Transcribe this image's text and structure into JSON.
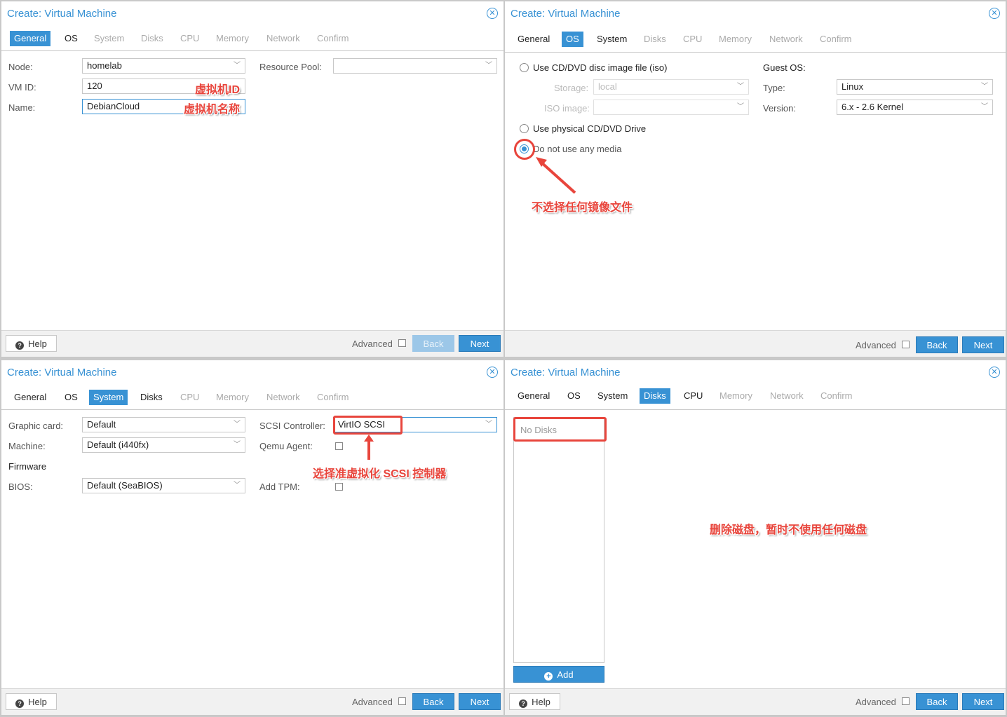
{
  "dialog_title": "Create: Virtual Machine",
  "tabs": [
    "General",
    "OS",
    "System",
    "Disks",
    "CPU",
    "Memory",
    "Network",
    "Confirm"
  ],
  "footer": {
    "help": "Help",
    "advanced": "Advanced",
    "back": "Back",
    "next": "Next",
    "add": "Add"
  },
  "general": {
    "node_label": "Node:",
    "node_value": "homelab",
    "vmid_label": "VM ID:",
    "vmid_value": "120",
    "name_label": "Name:",
    "name_value": "DebianCloud",
    "pool_label": "Resource Pool:",
    "anno_vmid": "虚拟机ID",
    "anno_name": "虚拟机名称"
  },
  "os": {
    "iso_option": "Use CD/DVD disc image file (iso)",
    "storage_label": "Storage:",
    "storage_value": "local",
    "iso_label": "ISO image:",
    "physical_option": "Use physical CD/DVD Drive",
    "none_option": "Do not use any media",
    "guest_label": "Guest OS:",
    "type_label": "Type:",
    "type_value": "Linux",
    "version_label": "Version:",
    "version_value": "6.x - 2.6 Kernel",
    "anno": "不选择任何镜像文件"
  },
  "system": {
    "graphic_label": "Graphic card:",
    "graphic_value": "Default",
    "machine_label": "Machine:",
    "machine_value": "Default (i440fx)",
    "firmware_label": "Firmware",
    "bios_label": "BIOS:",
    "bios_value": "Default (SeaBIOS)",
    "scsi_label": "SCSI Controller:",
    "scsi_value": "VirtIO SCSI",
    "qemu_label": "Qemu Agent:",
    "tpm_label": "Add TPM:",
    "anno": "选择准虚拟化 SCSI 控制器"
  },
  "disks": {
    "empty_text": "No Disks",
    "anno": "删除磁盘，暂时不使用任何磁盘"
  },
  "colors": {
    "accent": "#3892d4",
    "annotation": "#e8453c"
  }
}
